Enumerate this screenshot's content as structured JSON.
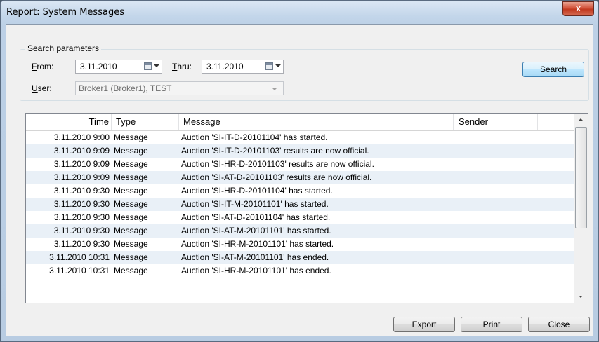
{
  "window": {
    "title": "Report: System Messages",
    "close_glyph": "x"
  },
  "search": {
    "group_title": "Search parameters",
    "from_label_key": "F",
    "from_label_rest": "rom:",
    "from_value": "3.11.2010",
    "thru_label_key": "T",
    "thru_label_rest": "hru:",
    "thru_value": "3.11.2010",
    "user_label_key": "U",
    "user_label_rest": "ser:",
    "user_value": "Broker1 (Broker1), TEST",
    "search_button": "Search"
  },
  "grid": {
    "columns": [
      "Time",
      "Type",
      "Message",
      "Sender"
    ],
    "rows": [
      {
        "time": "3.11.2010 9:00",
        "type": "Message",
        "message": "Auction 'SI-IT-D-20101104' has started."
      },
      {
        "time": "3.11.2010 9:09",
        "type": "Message",
        "message": "Auction 'SI-IT-D-20101103' results are now official."
      },
      {
        "time": "3.11.2010 9:09",
        "type": "Message",
        "message": "Auction 'SI-HR-D-20101103' results are now official."
      },
      {
        "time": "3.11.2010 9:09",
        "type": "Message",
        "message": "Auction 'SI-AT-D-20101103' results are now official."
      },
      {
        "time": "3.11.2010 9:30",
        "type": "Message",
        "message": "Auction 'SI-HR-D-20101104' has started."
      },
      {
        "time": "3.11.2010 9:30",
        "type": "Message",
        "message": "Auction 'SI-IT-M-20101101' has started."
      },
      {
        "time": "3.11.2010 9:30",
        "type": "Message",
        "message": "Auction 'SI-AT-D-20101104' has started."
      },
      {
        "time": "3.11.2010 9:30",
        "type": "Message",
        "message": "Auction 'SI-AT-M-20101101' has started."
      },
      {
        "time": "3.11.2010 9:30",
        "type": "Message",
        "message": "Auction 'SI-HR-M-20101101' has started."
      },
      {
        "time": "3.11.2010 10:31",
        "type": "Message",
        "message": "Auction 'SI-AT-M-20101101' has ended."
      },
      {
        "time": "3.11.2010 10:31",
        "type": "Message",
        "message": "Auction 'SI-HR-M-20101101' has ended."
      }
    ]
  },
  "footer": {
    "export": "Export",
    "print": "Print",
    "close": "Close"
  },
  "colors": {
    "row_alt": "#e9f0f7",
    "close_button": "#c7412a",
    "default_button_border": "#3c7fb1"
  },
  "icons": {
    "close": "close-icon",
    "calendar": "calendar-icon",
    "dropdown": "chevron-down-icon"
  }
}
